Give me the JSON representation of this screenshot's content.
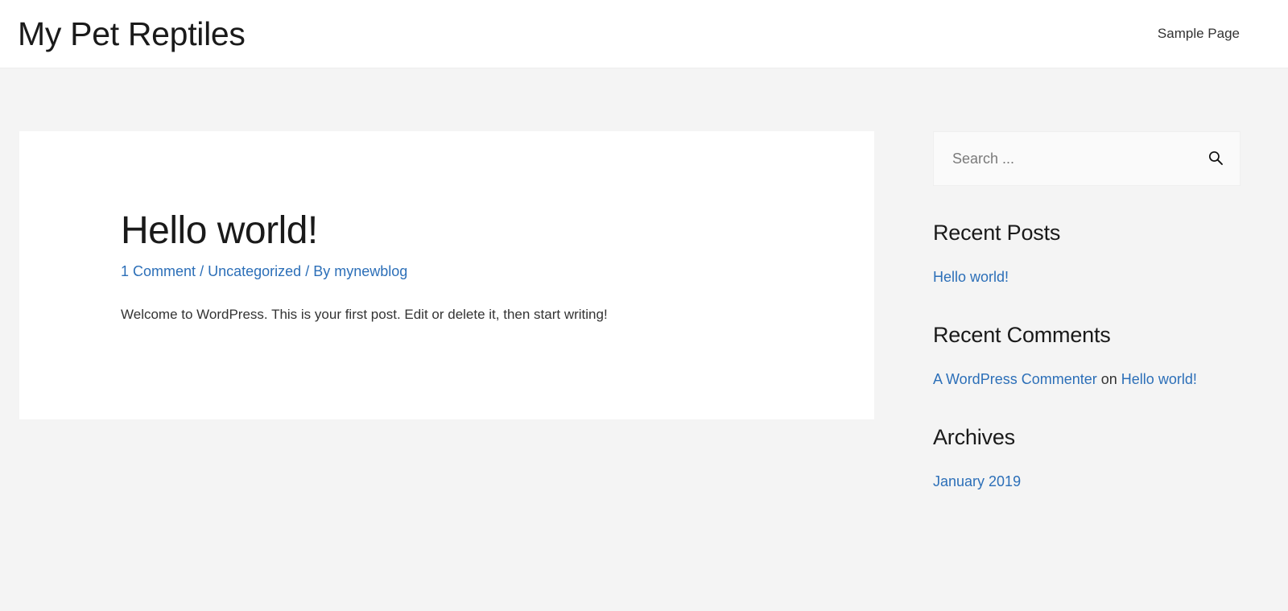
{
  "header": {
    "site_title": "My Pet Reptiles",
    "nav": [
      {
        "label": "Sample Page"
      }
    ]
  },
  "post": {
    "title": "Hello world!",
    "meta": {
      "comments": "1 Comment",
      "sep1": "/",
      "category": "Uncategorized",
      "sep2": "/",
      "byline": "By mynewblog"
    },
    "body": "Welcome to WordPress. This is your first post. Edit or delete it, then start writing!"
  },
  "sidebar": {
    "search": {
      "placeholder": "Search ...",
      "value": "",
      "icon": "search-icon"
    },
    "recent_posts": {
      "title": "Recent Posts",
      "items": [
        {
          "label": "Hello world!"
        }
      ]
    },
    "recent_comments": {
      "title": "Recent Comments",
      "items": [
        {
          "author": "A WordPress Commenter",
          "connector": "on",
          "post": "Hello world!"
        }
      ]
    },
    "archives": {
      "title": "Archives",
      "items": [
        {
          "label": "January 2019"
        }
      ]
    }
  },
  "colors": {
    "link": "#2c6fb8",
    "page_background": "#f4f4f4",
    "card_background": "#ffffff",
    "text": "#333333"
  }
}
